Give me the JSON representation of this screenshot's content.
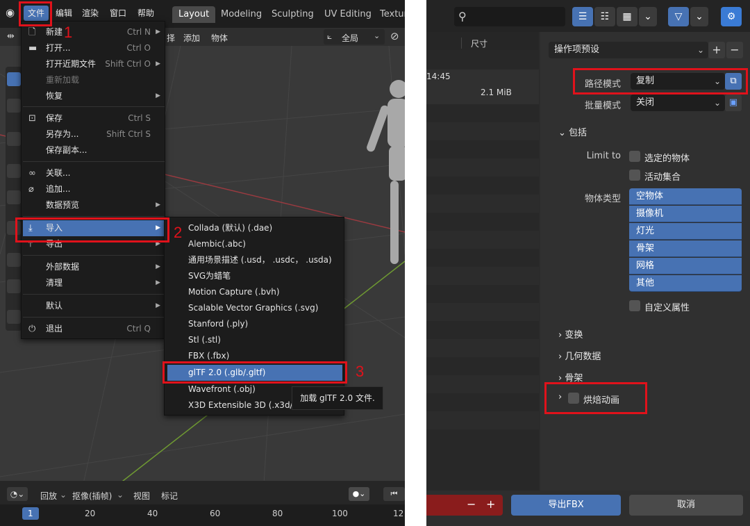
{
  "left": {
    "menubar": {
      "file": "文件",
      "edit": "编辑",
      "render": "渲染",
      "window": "窗口",
      "help": "帮助"
    },
    "workspace_tabs": [
      "Layout",
      "Modeling",
      "Sculpting",
      "UV Editing",
      "Textur"
    ],
    "header2": {
      "select": "择",
      "add": "添加",
      "object": "物体",
      "global": "全局"
    },
    "file_menu": [
      {
        "label": "新建",
        "shortcut": "Ctrl N",
        "icon": "new-file",
        "arrow": true
      },
      {
        "label": "打开...",
        "shortcut": "Ctrl O",
        "icon": "folder"
      },
      {
        "label": "打开近期文件",
        "shortcut": "Shift Ctrl O",
        "arrow": true
      },
      {
        "label": "重新加载",
        "dim": true
      },
      {
        "label": "恢复",
        "arrow": true
      },
      {
        "label": "保存",
        "shortcut": "Ctrl S",
        "icon": "save"
      },
      {
        "label": "另存为...",
        "shortcut": "Shift Ctrl S"
      },
      {
        "label": "保存副本..."
      },
      {
        "label": "关联...",
        "icon": "link"
      },
      {
        "label": "追加...",
        "icon": "paperclip"
      },
      {
        "label": "数据预览",
        "arrow": true
      },
      {
        "label": "导入",
        "icon": "import",
        "arrow": true,
        "highlight": true
      },
      {
        "label": "导出",
        "icon": "export",
        "arrow": true
      },
      {
        "label": "外部数据",
        "arrow": true
      },
      {
        "label": "清理",
        "arrow": true
      },
      {
        "label": "默认",
        "arrow": true
      },
      {
        "label": "退出",
        "shortcut": "Ctrl Q",
        "icon": "power"
      }
    ],
    "import_menu": [
      "Collada (默认) (.dae)",
      "Alembic(.abc)",
      "通用场景描述 (.usd， .usdc， .usda)",
      "SVG为蜡笔",
      "Motion Capture (.bvh)",
      "Scalable Vector Graphics (.svg)",
      "Stanford (.ply)",
      "Stl (.stl)",
      "FBX (.fbx)",
      "glTF 2.0 (.glb/.gltf)",
      "Wavefront (.obj)",
      "X3D Extensible 3D (.x3d/.wrl)"
    ],
    "import_highlight_index": 9,
    "tooltip": "加载 glTF 2.0 文件.",
    "step_numbers": [
      "1",
      "2",
      "3"
    ],
    "timeline": {
      "playback": "回放",
      "keying": "抠像(插帧)",
      "view": "视图",
      "marker": "标记"
    },
    "frames": [
      "1",
      "20",
      "40",
      "60",
      "80",
      "100",
      "12"
    ]
  },
  "right": {
    "file_columns": {
      "size_header": "尺寸",
      "time": "14:45",
      "size": "2.1 MiB"
    },
    "preset_label": "操作项预设",
    "path_mode_label": "路径模式",
    "path_mode_value": "复制",
    "batch_mode_label": "批量模式",
    "batch_mode_value": "关闭",
    "include_section": "包括",
    "limit_to_label": "Limit to",
    "limit_options": [
      "选定的物体",
      "活动集合"
    ],
    "object_types_label": "物体类型",
    "object_types": [
      "空物体",
      "摄像机",
      "灯光",
      "骨架",
      "网格",
      "其他"
    ],
    "custom_props": "自定义属性",
    "sections": [
      "变换",
      "几何数据",
      "骨架"
    ],
    "bake_anim": "烘焙动画",
    "export_button": "导出FBX",
    "cancel_button": "取消",
    "colors": {
      "accent": "#4772b3",
      "annotation": "#e0121b",
      "gear_button": "#3a7bd5"
    }
  }
}
